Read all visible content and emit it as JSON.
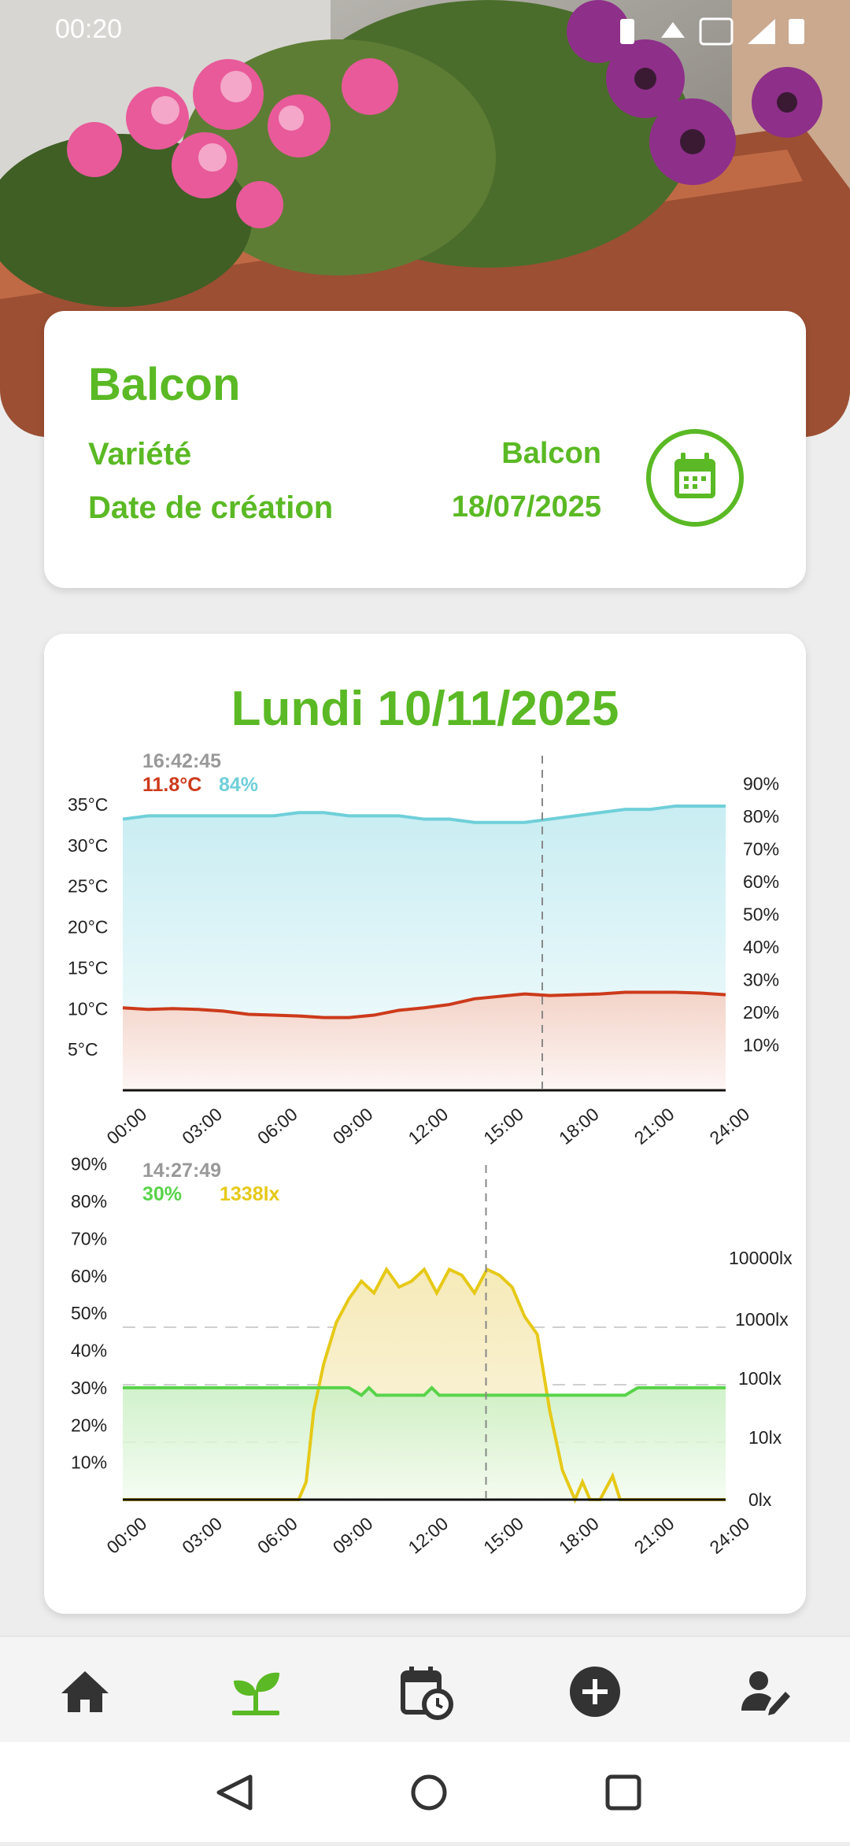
{
  "status": {
    "time": "00:20"
  },
  "plant": {
    "name": "Balcon",
    "variety_label": "Variété",
    "variety_value": "Balcon",
    "date_label": "Date de création",
    "date_value": "18/07/2025"
  },
  "chart_title": "Lundi 10/11/2025",
  "chart_data": [
    {
      "type": "line",
      "x_ticks": [
        "00:00",
        "03:00",
        "06:00",
        "09:00",
        "12:00",
        "15:00",
        "18:00",
        "21:00",
        "24:00"
      ],
      "y_left_ticks": [
        "35°C",
        "30°C",
        "25°C",
        "20°C",
        "15°C",
        "10°C",
        "5°C"
      ],
      "y_right_ticks": [
        "90%",
        "80%",
        "70%",
        "60%",
        "50%",
        "40%",
        "30%",
        "20%",
        "10%"
      ],
      "grid": true,
      "cursor": {
        "time": "16:42:45",
        "temp": "11.8°C",
        "humidity": "84%"
      },
      "series": [
        {
          "color": "#6fcfd9",
          "x": [
            0,
            1,
            2,
            3,
            4,
            5,
            6,
            7,
            8,
            9,
            10,
            11,
            12,
            13,
            14,
            15,
            16,
            17,
            18,
            19,
            20,
            21,
            22,
            23,
            24
          ],
          "values": [
            83,
            84,
            84,
            84,
            84,
            84,
            84,
            85,
            85,
            84,
            84,
            84,
            83,
            83,
            82,
            82,
            82,
            83,
            84,
            85,
            86,
            86,
            87,
            87,
            87
          ]
        },
        {
          "color": "#cc3a1b",
          "x": [
            0,
            1,
            2,
            3,
            4,
            5,
            6,
            7,
            8,
            9,
            10,
            11,
            12,
            13,
            14,
            15,
            16,
            17,
            18,
            19,
            20,
            21,
            22,
            23,
            24
          ],
          "values": [
            10.1,
            9.9,
            10.0,
            9.9,
            9.7,
            9.3,
            9.2,
            9.1,
            8.9,
            8.9,
            9.2,
            9.8,
            10.1,
            10.5,
            11.2,
            11.5,
            11.8,
            11.6,
            11.7,
            11.8,
            12.0,
            12.0,
            12.0,
            11.9,
            11.7
          ]
        }
      ]
    },
    {
      "type": "line",
      "x_ticks": [
        "00:00",
        "03:00",
        "06:00",
        "09:00",
        "12:00",
        "15:00",
        "18:00",
        "21:00",
        "24:00"
      ],
      "y_left_ticks": [
        "90%",
        "80%",
        "70%",
        "60%",
        "50%",
        "40%",
        "30%",
        "20%",
        "10%"
      ],
      "y_right_ticks": [
        "10000lx",
        "1000lx",
        "100lx",
        "10lx",
        "0lx"
      ],
      "grid": true,
      "cursor": {
        "time": "14:27:49",
        "moisture": "30%",
        "light": "1338lx"
      },
      "series": [
        {
          "color": "#59d34a",
          "x": [
            0,
            3,
            6,
            9,
            9.5,
            9.8,
            10.1,
            10.4,
            12.0,
            12.3,
            12.6,
            15,
            18,
            20,
            20.5,
            24
          ],
          "values": [
            30,
            30,
            30,
            30,
            28,
            30,
            28,
            28,
            28,
            30,
            28,
            28,
            28,
            28,
            30,
            30
          ]
        },
        {
          "color": "#e6c918",
          "x": [
            0,
            3,
            6,
            7.0,
            7.3,
            7.6,
            8,
            8.5,
            9,
            9.5,
            10,
            10.5,
            11,
            11.5,
            12,
            12.5,
            13,
            13.5,
            14,
            14.5,
            15,
            15.5,
            16,
            16.5,
            17,
            17.5,
            18,
            18.3,
            18.6,
            19,
            19.5,
            19.8,
            20,
            21,
            24
          ],
          "values": [
            0,
            0,
            0,
            0,
            0.3,
            1.5,
            2.3,
            3.0,
            3.4,
            3.7,
            3.5,
            3.9,
            3.6,
            3.7,
            3.9,
            3.5,
            3.9,
            3.8,
            3.5,
            3.9,
            3.8,
            3.6,
            3.1,
            2.8,
            1.5,
            0.5,
            0,
            0.3,
            0,
            0,
            0.4,
            0,
            0,
            0,
            0
          ]
        }
      ]
    }
  ],
  "nav": [
    "home",
    "plants",
    "calendar",
    "add",
    "account"
  ]
}
